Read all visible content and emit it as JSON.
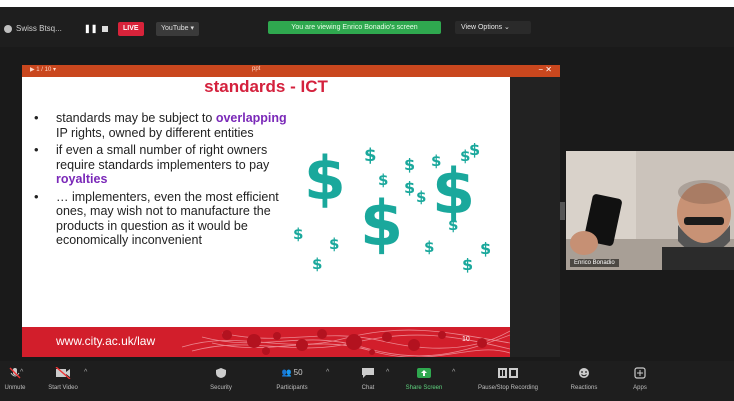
{
  "meeting": {
    "name": "Swiss Btsq...",
    "live": "LIVE",
    "youtube": "YouTube ▾",
    "viewing_banner": "You are viewing Enrico Bonadio's screen",
    "view_options": "View Options ⌄"
  },
  "ppt": {
    "window_title": "▶ 1 / 10 ▾",
    "center": "ppt",
    "controls": "− ✕"
  },
  "slide": {
    "title": "standards - ICT",
    "bullets": [
      {
        "pre": "standards may be subject to ",
        "hl": "overlapping",
        "post": " IP rights, owned by different entities"
      },
      {
        "pre": "if even a small number of right owners require standards implementers to pay ",
        "hl": "royalties",
        "post": ""
      },
      {
        "pre": "… implementers, even the most efficient ones, may wish not to manufacture the products in question as it would be economically inconvenient",
        "hl": "",
        "post": ""
      }
    ],
    "footer_url": "www.city.ac.uk/law",
    "slide_number": "10"
  },
  "webcam": {
    "name": "Enrico Bonadio"
  },
  "toolbar": {
    "items": [
      {
        "label": "Unmute",
        "icon": "microphone-icon"
      },
      {
        "label": "Start Video",
        "icon": "video-icon"
      },
      {
        "label": "Security",
        "icon": "shield-icon"
      },
      {
        "label": "Participants",
        "icon": "participants-icon",
        "count": "50"
      },
      {
        "label": "Chat",
        "icon": "chat-icon"
      },
      {
        "label": "Share Screen",
        "icon": "share-screen-icon"
      },
      {
        "label": "Pause/Stop Recording",
        "icon": "recording-icon"
      },
      {
        "label": "Reactions",
        "icon": "reactions-icon"
      },
      {
        "label": "Apps",
        "icon": "apps-icon"
      }
    ]
  },
  "colors": {
    "accent_green": "#2fa84f",
    "slide_red": "#d21e2b",
    "dollar_teal": "#1aa89c",
    "highlight_purple": "#7a28b8"
  }
}
